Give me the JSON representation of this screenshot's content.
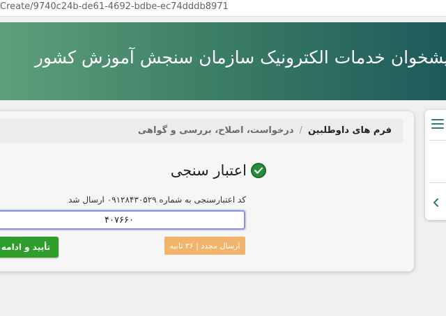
{
  "browser": {
    "url": "Create/9740c24b-de61-4692-bdbe-ec74dddb8971"
  },
  "banner": {
    "title": "پیشخوان خدمات الکترونیک سازمان سنجش آموزش کشور"
  },
  "breadcrumb": {
    "current": "فرم های داوطلبین",
    "separator": "/",
    "section": "درخواست، اصلاح، بررسی و گواهی"
  },
  "verification": {
    "heading": "اعتبار سنجی",
    "heading_icon": "check-circle-icon",
    "sms_note": "کد اعتبارسنجی به شماره ۰۹۱۲۸۴۳۰۵۲۹ ارسال شد",
    "code_value": "۴۰۷۶۶۰",
    "resend_label": "ارسال مجدد | ۳۶ ثانیه",
    "confirm_label": "تأیید و ادامه"
  },
  "sidebar": {
    "menu_icon": "hamburger-menu-icon",
    "chevron_icon": "chevron-left-icon"
  },
  "colors": {
    "banner_start": "#5e9f7b",
    "banner_end": "#1e5a5b",
    "success_green": "#2e9d2c",
    "resend_orange": "#f2b46d",
    "menu_teal": "#2a7d6e"
  }
}
